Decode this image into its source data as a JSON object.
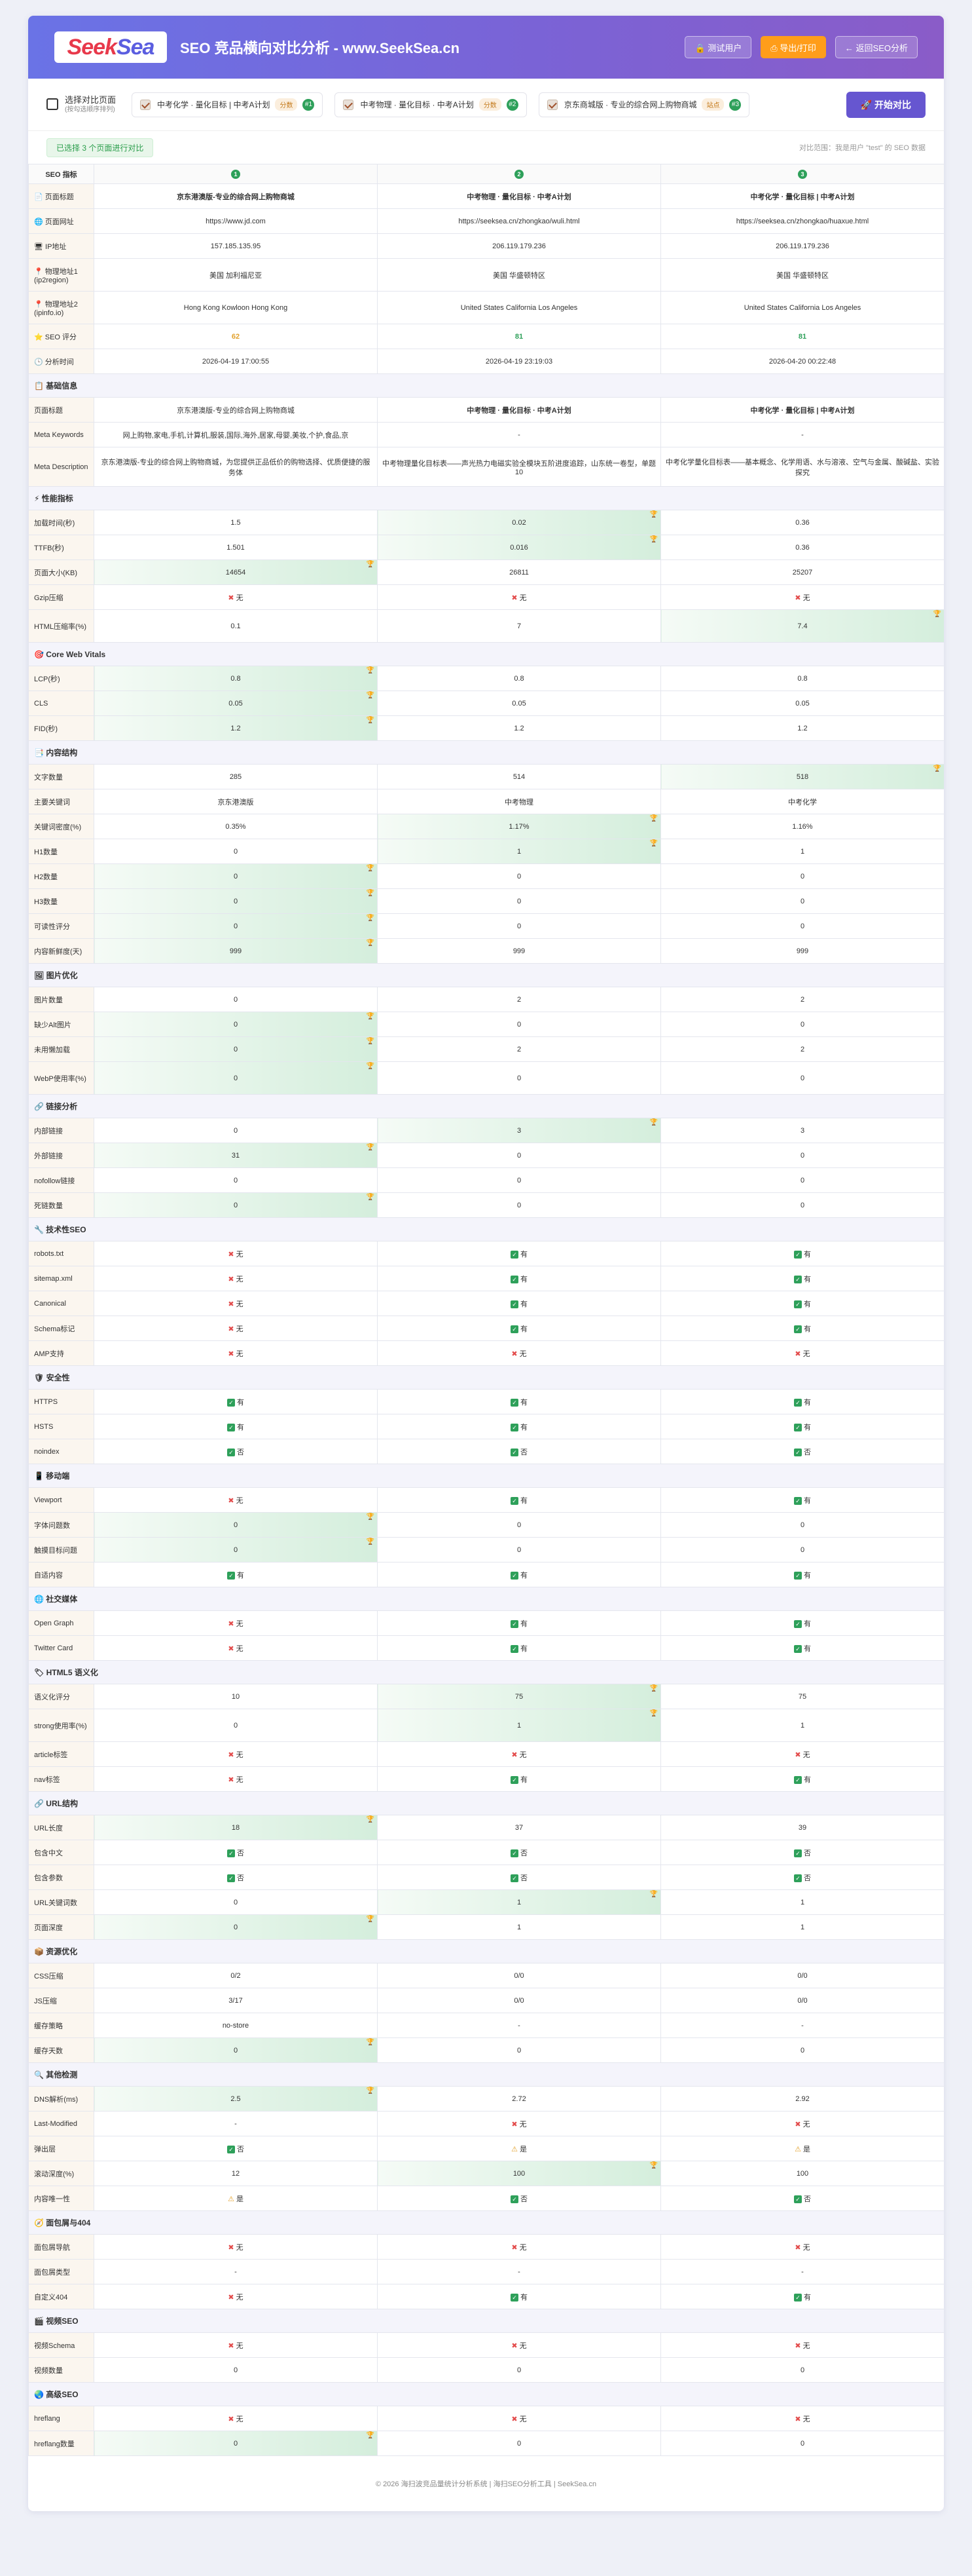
{
  "header": {
    "logo_a": "Seek",
    "logo_b": "Sea",
    "title": "SEO 竞品横向对比分析 - www.SeekSea.cn",
    "user": "🔒 测试用户",
    "print": "⎙ 导出/打印",
    "back": "← 返回SEO分析"
  },
  "select": {
    "title": "选择对比页面",
    "sub": "(按勾选顺序排列)",
    "start": "🚀 开始对比",
    "chips": [
      {
        "label": "中考化学 · 量化目标 | 中考A计划",
        "tag": "分数",
        "num": "#1"
      },
      {
        "label": "中考物理 · 量化目标 · 中考A计划",
        "tag": "分数",
        "num": "#2"
      },
      {
        "label": "京东商城版 · 专业的综合网上购物商城",
        "tag": "站点",
        "num": "#3"
      }
    ]
  },
  "info": {
    "left": "已选择 3 个页面进行对比",
    "right": "对比范围：我是用户 \"test\" 的 SEO 数据"
  },
  "table": {
    "col0": "SEO 指标",
    "cols": [
      "1",
      "2",
      "3"
    ]
  },
  "rows": [
    {
      "t": "r",
      "l": "📄 页面标题",
      "v": [
        "<b>京东港澳版-专业的综合网上购物商城</b>",
        "<b>中考物理 · 量化目标 · 中考A计划</b>",
        "<b>中考化学 · 量化目标 | 中考A计划</b>"
      ]
    },
    {
      "t": "r",
      "l": "🌐 页面网址",
      "v": [
        "https://www.jd.com",
        "https://seeksea.cn/zhongkao/wuli.html",
        "https://seeksea.cn/zhongkao/huaxue.html"
      ]
    },
    {
      "t": "r",
      "l": "🖥 IP地址",
      "v": [
        "157.185.135.95",
        "206.119.179.236",
        "206.119.179.236"
      ]
    },
    {
      "t": "tall",
      "l": "📍 物理地址1 (ip2region)",
      "v": [
        "美国 加利福尼亚",
        "美国 华盛顿特区",
        "美国 华盛顿特区"
      ]
    },
    {
      "t": "tall",
      "l": "📍 物理地址2 (ipinfo.io)",
      "v": [
        "Hong Kong Kowloon Hong Kong",
        "United States California Los Angeles",
        "United States California Los Angeles"
      ]
    },
    {
      "t": "r",
      "l": "⭐ SEO 评分",
      "v": [
        "<span class=y>62</span>",
        "<span class=g>81</span>",
        "<span class=g>81</span>"
      ]
    },
    {
      "t": "r",
      "l": "🕒 分析时间",
      "v": [
        "2026-04-19 17:00:55",
        "2026-04-19 23:19:03",
        "2026-04-20 00:22:48"
      ]
    },
    {
      "t": "sec",
      "l": "📋 基础信息"
    },
    {
      "t": "r",
      "l": "页面标题",
      "v": [
        "京东港澳版-专业的综合网上购物商城",
        "<b>中考物理 · 量化目标 · 中考A计划</b>",
        "<b>中考化学 · 量化目标 | 中考A计划</b>"
      ]
    },
    {
      "t": "r",
      "l": "Meta Keywords",
      "v": [
        "网上购物,家电,手机,计算机,服装,国际,海外,居家,母婴,美妆,个护,食品,京",
        "-",
        "-"
      ]
    },
    {
      "t": "xtall",
      "l": "Meta Description",
      "v": [
        "京东港澳版-专业的综合网上购物商城，为您提供正品低价的购物选择、优质便捷的服务体",
        "中考物理量化目标表——声光热力电磁实验全模块五阶进度追踪，山东统一卷型，单题10",
        "中考化学量化目标表——基本概念、化学用语、水与溶液、空气与金属、酸碱盐、实验探究"
      ]
    },
    {
      "t": "sec",
      "l": "⚡ 性能指标"
    },
    {
      "t": "r",
      "l": "加载时间(秒)",
      "v": [
        "1.5",
        "0.02",
        "0.36"
      ],
      "b": [
        1
      ]
    },
    {
      "t": "r",
      "l": "TTFB(秒)",
      "v": [
        "1.501",
        "0.016",
        "0.36"
      ],
      "b": [
        1
      ]
    },
    {
      "t": "r",
      "l": "页面大小(KB)",
      "v": [
        "14654",
        "26811",
        "25207"
      ],
      "b": [
        0
      ]
    },
    {
      "t": "r",
      "l": "Gzip压缩",
      "v": [
        "<span class=no>✖</span>无",
        "<span class=no>✖</span>无",
        "<span class=no>✖</span>无"
      ]
    },
    {
      "t": "tall",
      "l": "HTML压缩率(%)",
      "v": [
        "0.1",
        "7",
        "7.4"
      ],
      "b": [
        2
      ]
    },
    {
      "t": "sec",
      "l": "🎯 Core Web Vitals"
    },
    {
      "t": "r",
      "l": "LCP(秒)",
      "v": [
        "0.8",
        "0.8",
        "0.8"
      ],
      "b": [
        0
      ]
    },
    {
      "t": "r",
      "l": "CLS",
      "v": [
        "0.05",
        "0.05",
        "0.05"
      ],
      "b": [
        0
      ]
    },
    {
      "t": "r",
      "l": "FID(秒)",
      "v": [
        "1.2",
        "1.2",
        "1.2"
      ],
      "b": [
        0
      ]
    },
    {
      "t": "sec",
      "l": "📑 内容结构"
    },
    {
      "t": "r",
      "l": "文字数量",
      "v": [
        "285",
        "514",
        "518"
      ],
      "b": [
        2
      ]
    },
    {
      "t": "r",
      "l": "主要关键词",
      "v": [
        "京东港澳版",
        "中考物理",
        "中考化学"
      ]
    },
    {
      "t": "r",
      "l": "关键词密度(%)",
      "v": [
        "0.35%",
        "1.17%",
        "1.16%"
      ],
      "b": [
        1
      ]
    },
    {
      "t": "r",
      "l": "H1数量",
      "v": [
        "0",
        "1",
        "1"
      ],
      "b": [
        1
      ]
    },
    {
      "t": "r",
      "l": "H2数量",
      "v": [
        "0",
        "0",
        "0"
      ],
      "b": [
        0
      ]
    },
    {
      "t": "r",
      "l": "H3数量",
      "v": [
        "0",
        "0",
        "0"
      ],
      "b": [
        0
      ]
    },
    {
      "t": "r",
      "l": "可读性评分",
      "v": [
        "0",
        "0",
        "0"
      ],
      "b": [
        0
      ]
    },
    {
      "t": "r",
      "l": "内容新鲜度(天)",
      "v": [
        "999",
        "999",
        "999"
      ],
      "b": [
        0
      ]
    },
    {
      "t": "sec",
      "l": "🖼 图片优化"
    },
    {
      "t": "r",
      "l": "图片数量",
      "v": [
        "0",
        "2",
        "2"
      ]
    },
    {
      "t": "r",
      "l": "缺少Alt图片",
      "v": [
        "0",
        "0",
        "0"
      ],
      "b": [
        0
      ]
    },
    {
      "t": "r",
      "l": "未用懒加载",
      "v": [
        "0",
        "2",
        "2"
      ],
      "b": [
        0
      ]
    },
    {
      "t": "tall",
      "l": "WebP使用率(%)",
      "v": [
        "0",
        "0",
        "0"
      ],
      "b": [
        0
      ]
    },
    {
      "t": "sec",
      "l": "🔗 链接分析"
    },
    {
      "t": "r",
      "l": "内部链接",
      "v": [
        "0",
        "3",
        "3"
      ],
      "b": [
        1
      ]
    },
    {
      "t": "r",
      "l": "外部链接",
      "v": [
        "31",
        "0",
        "0"
      ],
      "b": [
        0
      ]
    },
    {
      "t": "r",
      "l": "nofollow链接",
      "v": [
        "0",
        "0",
        "0"
      ]
    },
    {
      "t": "r",
      "l": "死链数量",
      "v": [
        "0",
        "0",
        "0"
      ],
      "b": [
        0
      ]
    },
    {
      "t": "sec",
      "l": "🔧 技术性SEO"
    },
    {
      "t": "r",
      "l": "robots.txt",
      "v": [
        "<span class=no>✖</span>无",
        "<span class=ok>✓</span>有",
        "<span class=ok>✓</span>有"
      ]
    },
    {
      "t": "r",
      "l": "sitemap.xml",
      "v": [
        "<span class=no>✖</span>无",
        "<span class=ok>✓</span>有",
        "<span class=ok>✓</span>有"
      ]
    },
    {
      "t": "r",
      "l": "Canonical",
      "v": [
        "<span class=no>✖</span>无",
        "<span class=ok>✓</span>有",
        "<span class=ok>✓</span>有"
      ]
    },
    {
      "t": "r",
      "l": "Schema标记",
      "v": [
        "<span class=no>✖</span>无",
        "<span class=ok>✓</span>有",
        "<span class=ok>✓</span>有"
      ]
    },
    {
      "t": "r",
      "l": "AMP支持",
      "v": [
        "<span class=no>✖</span>无",
        "<span class=no>✖</span>无",
        "<span class=no>✖</span>无"
      ]
    },
    {
      "t": "sec",
      "l": "🛡 安全性"
    },
    {
      "t": "r",
      "l": "HTTPS",
      "v": [
        "<span class=ok>✓</span>有",
        "<span class=ok>✓</span>有",
        "<span class=ok>✓</span>有"
      ]
    },
    {
      "t": "r",
      "l": "HSTS",
      "v": [
        "<span class=ok>✓</span>有",
        "<span class=ok>✓</span>有",
        "<span class=ok>✓</span>有"
      ]
    },
    {
      "t": "r",
      "l": "noindex",
      "v": [
        "<span class=ok>✓</span>否",
        "<span class=ok>✓</span>否",
        "<span class=ok>✓</span>否"
      ]
    },
    {
      "t": "sec",
      "l": "📱 移动端"
    },
    {
      "t": "r",
      "l": "Viewport",
      "v": [
        "<span class=no>✖</span>无",
        "<span class=ok>✓</span>有",
        "<span class=ok>✓</span>有"
      ]
    },
    {
      "t": "r",
      "l": "字体问题数",
      "v": [
        "0",
        "0",
        "0"
      ],
      "b": [
        0
      ]
    },
    {
      "t": "r",
      "l": "触摸目标问题",
      "v": [
        "0",
        "0",
        "0"
      ],
      "b": [
        0
      ]
    },
    {
      "t": "r",
      "l": "自适内容",
      "v": [
        "<span class=ok>✓</span>有",
        "<span class=ok>✓</span>有",
        "<span class=ok>✓</span>有"
      ]
    },
    {
      "t": "sec",
      "l": "🌐 社交媒体"
    },
    {
      "t": "r",
      "l": "Open Graph",
      "v": [
        "<span class=no>✖</span>无",
        "<span class=ok>✓</span>有",
        "<span class=ok>✓</span>有"
      ]
    },
    {
      "t": "r",
      "l": "Twitter Card",
      "v": [
        "<span class=no>✖</span>无",
        "<span class=ok>✓</span>有",
        "<span class=ok>✓</span>有"
      ]
    },
    {
      "t": "sec",
      "l": "🏷 HTML5 语义化"
    },
    {
      "t": "r",
      "l": "语义化评分",
      "v": [
        "10",
        "75",
        "75"
      ],
      "b": [
        1
      ]
    },
    {
      "t": "tall",
      "l": "strong使用率(%)",
      "v": [
        "0",
        "1",
        "1"
      ],
      "b": [
        1
      ]
    },
    {
      "t": "r",
      "l": "article标签",
      "v": [
        "<span class=no>✖</span>无",
        "<span class=no>✖</span>无",
        "<span class=no>✖</span>无"
      ]
    },
    {
      "t": "r",
      "l": "nav标签",
      "v": [
        "<span class=no>✖</span>无",
        "<span class=ok>✓</span>有",
        "<span class=ok>✓</span>有"
      ]
    },
    {
      "t": "sec",
      "l": "🔗 URL结构"
    },
    {
      "t": "r",
      "l": "URL长度",
      "v": [
        "18",
        "37",
        "39"
      ],
      "b": [
        0
      ]
    },
    {
      "t": "r",
      "l": "包含中文",
      "v": [
        "<span class=ok>✓</span>否",
        "<span class=ok>✓</span>否",
        "<span class=ok>✓</span>否"
      ]
    },
    {
      "t": "r",
      "l": "包含参数",
      "v": [
        "<span class=ok>✓</span>否",
        "<span class=ok>✓</span>否",
        "<span class=ok>✓</span>否"
      ]
    },
    {
      "t": "r",
      "l": "URL关键词数",
      "v": [
        "0",
        "1",
        "1"
      ],
      "b": [
        1
      ]
    },
    {
      "t": "r",
      "l": "页面深度",
      "v": [
        "0",
        "1",
        "1"
      ],
      "b": [
        0
      ]
    },
    {
      "t": "sec",
      "l": "📦 资源优化"
    },
    {
      "t": "r",
      "l": "CSS压缩",
      "v": [
        "0/2",
        "0/0",
        "0/0"
      ]
    },
    {
      "t": "r",
      "l": "JS压缩",
      "v": [
        "3/17",
        "0/0",
        "0/0"
      ]
    },
    {
      "t": "r",
      "l": "缓存策略",
      "v": [
        "no-store",
        "-",
        "-"
      ]
    },
    {
      "t": "r",
      "l": "缓存天数",
      "v": [
        "0",
        "0",
        "0"
      ],
      "b": [
        0
      ]
    },
    {
      "t": "sec",
      "l": "🔍 其他检测"
    },
    {
      "t": "r",
      "l": "DNS解析(ms)",
      "v": [
        "2.5",
        "2.72",
        "2.92"
      ],
      "b": [
        0
      ]
    },
    {
      "t": "r",
      "l": "Last-Modified",
      "v": [
        "-",
        "<span class=no>✖</span>无",
        "<span class=no>✖</span>无"
      ]
    },
    {
      "t": "r",
      "l": "弹出层",
      "v": [
        "<span class=ok>✓</span>否",
        "<span class=wa>⚠</span>是",
        "<span class=wa>⚠</span>是"
      ]
    },
    {
      "t": "r",
      "l": "滚动深度(%)",
      "v": [
        "12",
        "100",
        "100"
      ],
      "b": [
        1
      ]
    },
    {
      "t": "r",
      "l": "内容唯一性",
      "v": [
        "<span class=wa>⚠</span>是",
        "<span class=ok>✓</span>否",
        "<span class=ok>✓</span>否"
      ]
    },
    {
      "t": "sec",
      "l": "🧭 面包屑与404"
    },
    {
      "t": "r",
      "l": "面包屑导航",
      "v": [
        "<span class=no>✖</span>无",
        "<span class=no>✖</span>无",
        "<span class=no>✖</span>无"
      ]
    },
    {
      "t": "r",
      "l": "面包屑类型",
      "v": [
        "-",
        "-",
        "-"
      ]
    },
    {
      "t": "r",
      "l": "自定义404",
      "v": [
        "<span class=no>✖</span>无",
        "<span class=ok>✓</span>有",
        "<span class=ok>✓</span>有"
      ]
    },
    {
      "t": "sec",
      "l": "🎬 视频SEO"
    },
    {
      "t": "r",
      "l": "视频Schema",
      "v": [
        "<span class=no>✖</span>无",
        "<span class=no>✖</span>无",
        "<span class=no>✖</span>无"
      ]
    },
    {
      "t": "r",
      "l": "视频数量",
      "v": [
        "0",
        "0",
        "0"
      ]
    },
    {
      "t": "sec",
      "l": "🌏 高级SEO"
    },
    {
      "t": "r",
      "l": "hreflang",
      "v": [
        "<span class=no>✖</span>无",
        "<span class=no>✖</span>无",
        "<span class=no>✖</span>无"
      ]
    },
    {
      "t": "r",
      "l": "hreflang数量",
      "v": [
        "0",
        "0",
        "0"
      ],
      "b": [
        0
      ]
    }
  ],
  "footer": "© 2026 海扫波竞品量统计分析系统 | 海扫SEO分析工具 | SeekSea.cn"
}
